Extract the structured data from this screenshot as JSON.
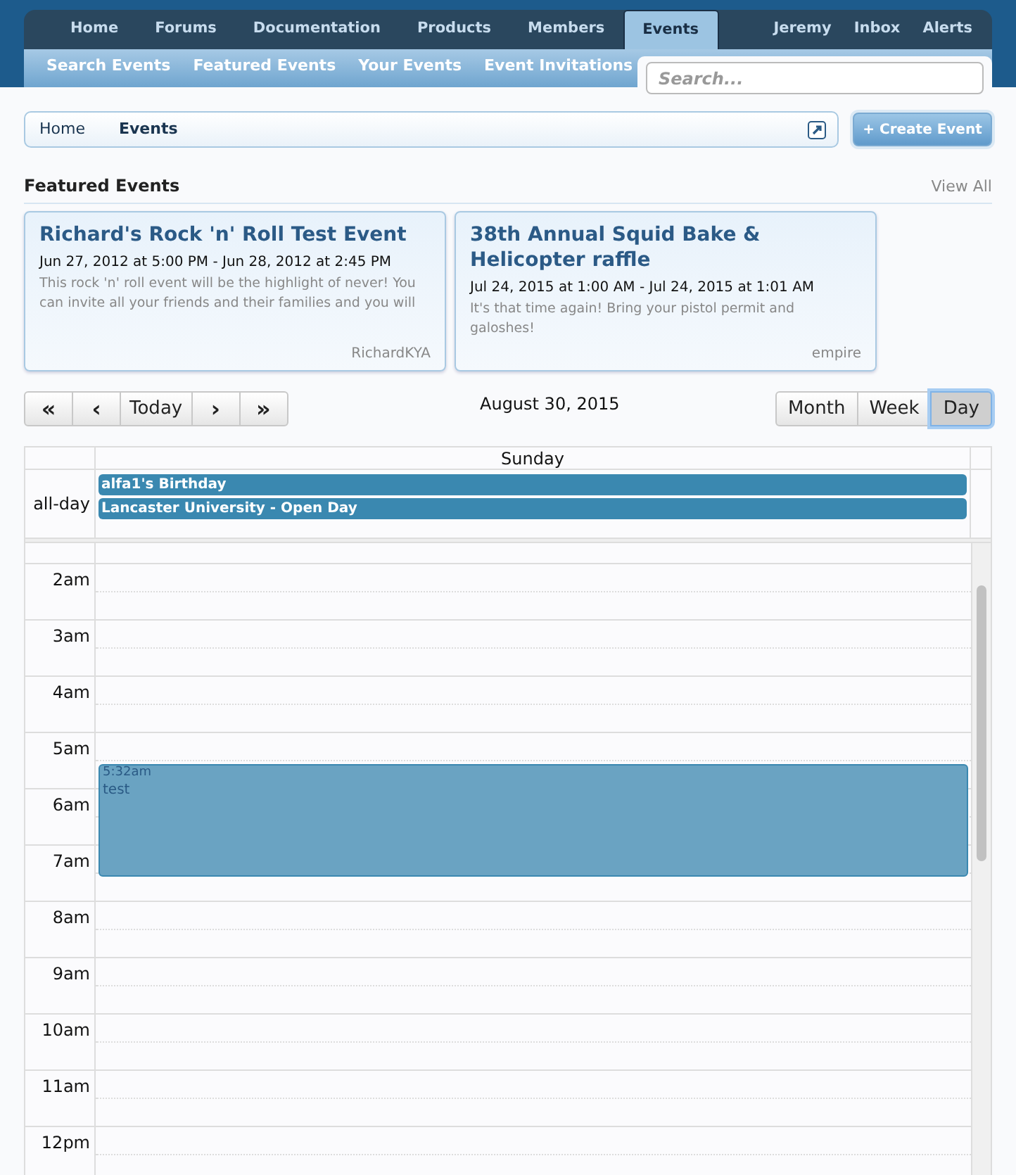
{
  "nav": {
    "tabs": [
      {
        "label": "Home",
        "selected": false
      },
      {
        "label": "Forums",
        "selected": false
      },
      {
        "label": "Documentation",
        "selected": false
      },
      {
        "label": "Products",
        "selected": false
      },
      {
        "label": "Members",
        "selected": false
      },
      {
        "label": "Events",
        "selected": true
      }
    ],
    "user_links": [
      "Jeremy",
      "Inbox",
      "Alerts"
    ],
    "sub_links": [
      "Search Events",
      "Featured Events",
      "Your Events",
      "Event Invitations"
    ],
    "search": {
      "placeholder": "Search..."
    }
  },
  "breadcrumb": [
    "Home",
    "Events"
  ],
  "create_button": "+ Create Event",
  "featured": {
    "title": "Featured Events",
    "view_all": "View All",
    "events": [
      {
        "title": "Richard's Rock 'n' Roll Test Event",
        "dates": "Jun 27, 2012 at 5:00 PM - Jun 28, 2012 at 2:45 PM",
        "description": "This rock 'n' roll event will be the highlight of never! You can invite all your friends and their families and you will",
        "author": "RichardKYA"
      },
      {
        "title": "38th Annual Squid Bake & Helicopter raffle",
        "dates": "Jul 24, 2015 at 1:00 AM - Jul 24, 2015 at 1:01 AM",
        "description": "It's that time again! Bring your pistol permit and galoshes!",
        "author": "empire"
      }
    ]
  },
  "calendar": {
    "nav_buttons": [
      "«",
      "‹",
      "Today",
      "›",
      "»"
    ],
    "date": "August 30, 2015",
    "views": [
      {
        "label": "Month",
        "selected": false
      },
      {
        "label": "Week",
        "selected": false
      },
      {
        "label": "Day",
        "selected": true
      }
    ],
    "day_header": "Sunday",
    "all_day_label": "all-day",
    "all_day_events": [
      "alfa1's Birthday",
      "Lancaster University - Open Day"
    ],
    "hours": [
      "2am",
      "3am",
      "4am",
      "5am",
      "6am",
      "7am",
      "8am",
      "9am",
      "10am",
      "11am",
      "12pm"
    ],
    "timed_events": [
      {
        "time": "5:32am",
        "title": "test"
      }
    ]
  }
}
